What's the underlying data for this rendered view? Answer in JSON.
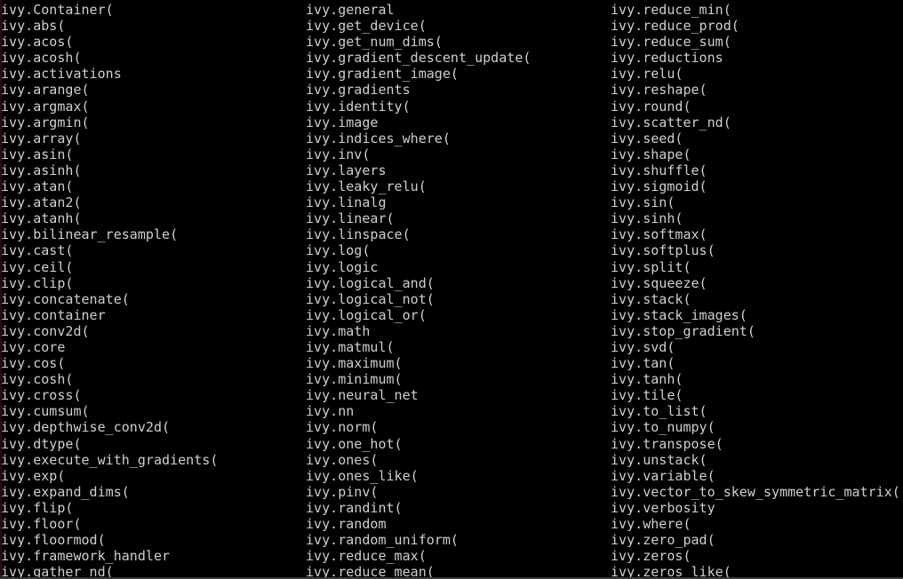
{
  "terminal": {
    "background_color": "#000000",
    "text_color": "#d0cfcc",
    "edge_color": "#2a0a14",
    "bottom_edge_color": "#3a3a3a",
    "columns": 3,
    "rows": 36,
    "completion_columns": [
      [
        "ivy.Container(",
        "ivy.abs(",
        "ivy.acos(",
        "ivy.acosh(",
        "ivy.activations",
        "ivy.arange(",
        "ivy.argmax(",
        "ivy.argmin(",
        "ivy.array(",
        "ivy.asin(",
        "ivy.asinh(",
        "ivy.atan(",
        "ivy.atan2(",
        "ivy.atanh(",
        "ivy.bilinear_resample(",
        "ivy.cast(",
        "ivy.ceil(",
        "ivy.clip(",
        "ivy.concatenate(",
        "ivy.container",
        "ivy.conv2d(",
        "ivy.core",
        "ivy.cos(",
        "ivy.cosh(",
        "ivy.cross(",
        "ivy.cumsum(",
        "ivy.depthwise_conv2d(",
        "ivy.dtype(",
        "ivy.execute_with_gradients(",
        "ivy.exp(",
        "ivy.expand_dims(",
        "ivy.flip(",
        "ivy.floor(",
        "ivy.floormod(",
        "ivy.framework_handler",
        "ivy.gather_nd("
      ],
      [
        "ivy.general",
        "ivy.get_device(",
        "ivy.get_num_dims(",
        "ivy.gradient_descent_update(",
        "ivy.gradient_image(",
        "ivy.gradients",
        "ivy.identity(",
        "ivy.image",
        "ivy.indices_where(",
        "ivy.inv(",
        "ivy.layers",
        "ivy.leaky_relu(",
        "ivy.linalg",
        "ivy.linear(",
        "ivy.linspace(",
        "ivy.log(",
        "ivy.logic",
        "ivy.logical_and(",
        "ivy.logical_not(",
        "ivy.logical_or(",
        "ivy.math",
        "ivy.matmul(",
        "ivy.maximum(",
        "ivy.minimum(",
        "ivy.neural_net",
        "ivy.nn",
        "ivy.norm(",
        "ivy.one_hot(",
        "ivy.ones(",
        "ivy.ones_like(",
        "ivy.pinv(",
        "ivy.randint(",
        "ivy.random",
        "ivy.random_uniform(",
        "ivy.reduce_max(",
        "ivy.reduce_mean("
      ],
      [
        "ivy.reduce_min(",
        "ivy.reduce_prod(",
        "ivy.reduce_sum(",
        "ivy.reductions",
        "ivy.relu(",
        "ivy.reshape(",
        "ivy.round(",
        "ivy.scatter_nd(",
        "ivy.seed(",
        "ivy.shape(",
        "ivy.shuffle(",
        "ivy.sigmoid(",
        "ivy.sin(",
        "ivy.sinh(",
        "ivy.softmax(",
        "ivy.softplus(",
        "ivy.split(",
        "ivy.squeeze(",
        "ivy.stack(",
        "ivy.stack_images(",
        "ivy.stop_gradient(",
        "ivy.svd(",
        "ivy.tan(",
        "ivy.tanh(",
        "ivy.tile(",
        "ivy.to_list(",
        "ivy.to_numpy(",
        "ivy.transpose(",
        "ivy.unstack(",
        "ivy.variable(",
        "ivy.vector_to_skew_symmetric_matrix(",
        "ivy.verbosity",
        "ivy.where(",
        "ivy.zero_pad(",
        "ivy.zeros(",
        "ivy.zeros_like("
      ]
    ]
  }
}
